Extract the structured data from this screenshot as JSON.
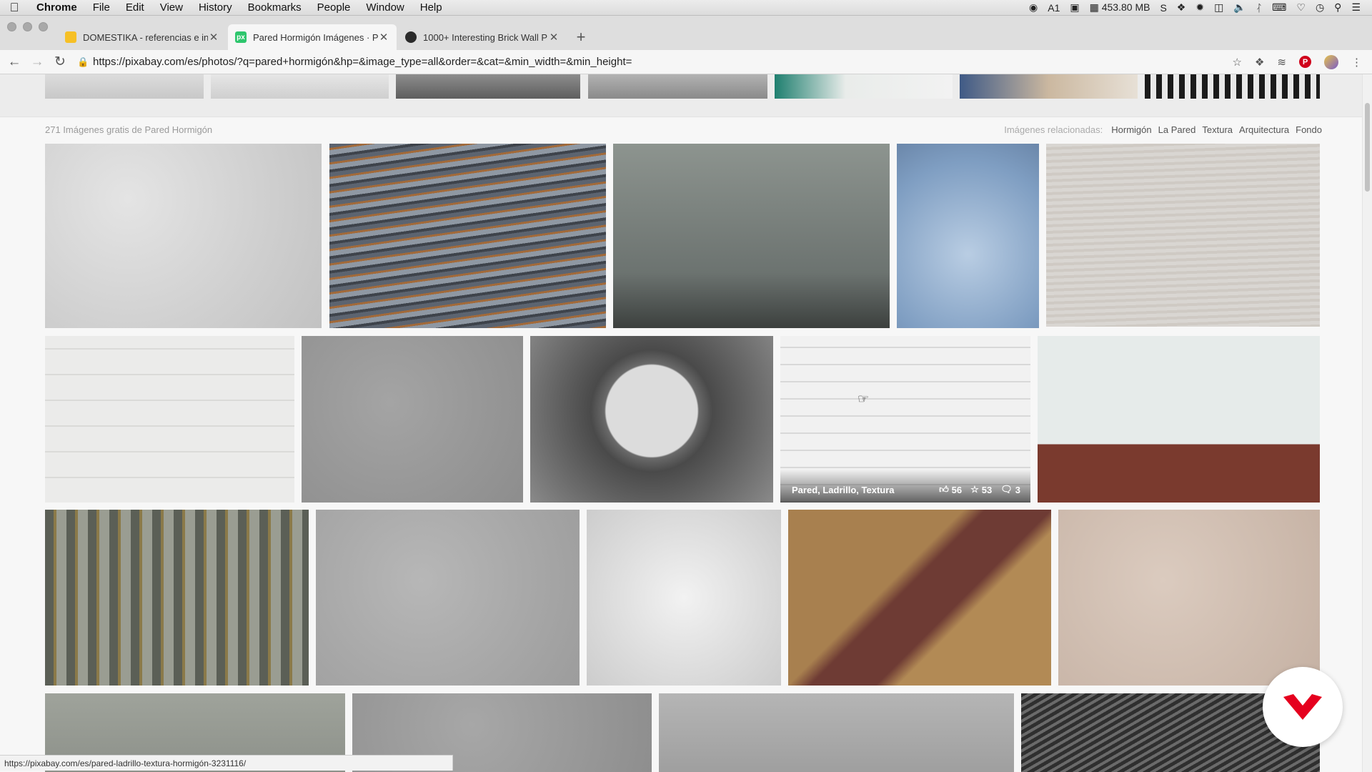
{
  "menubar": {
    "app_name": "Chrome",
    "items": [
      "File",
      "Edit",
      "View",
      "History",
      "Bookmarks",
      "People",
      "Window",
      "Help"
    ],
    "status": {
      "memory": "453.80 MB",
      "tray_number": "1"
    }
  },
  "tabs": [
    {
      "title": "DOMESTIKA - referencias e in",
      "favicon_color": "#f6c026",
      "active": false
    },
    {
      "title": "Pared Hormigón Imágenes · P",
      "favicon_color": "#2ec66d",
      "favicon_text": "px",
      "active": true
    },
    {
      "title": "1000+ Interesting Brick Wall P",
      "favicon_color": "#2b2b2b",
      "active": false
    }
  ],
  "toolbar": {
    "url": "https://pixabay.com/es/photos/?q=pared+hormigón&hp=&image_type=all&order=&cat=&min_width=&min_height="
  },
  "page": {
    "results_count": "271 Imágenes gratis de Pared Hormigón",
    "related_label": "Imágenes relacionadas:",
    "related_links": [
      "Hormigón",
      "La Pared",
      "Textura",
      "Arquitectura",
      "Fondo"
    ],
    "hovered_image": {
      "tags": "Pared, Ladrillo, Textura",
      "likes": "56",
      "favorites": "53",
      "comments": "3"
    },
    "status_url": "https://pixabay.com/es/pared-ladrillo-textura-hormigón-3231116/"
  },
  "colors": {
    "accent_red": "#d0021b",
    "domestika_red": "#e5001e"
  }
}
